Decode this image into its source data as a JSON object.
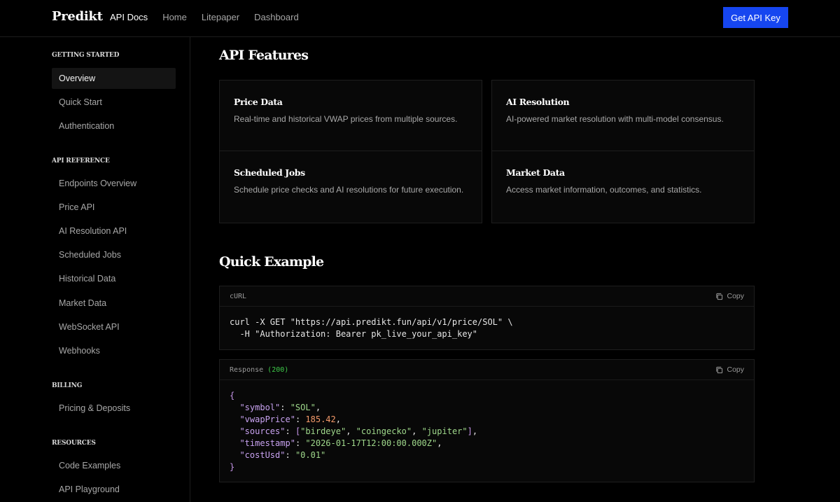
{
  "brand": "Predikt",
  "nav": [
    "API Docs",
    "Home",
    "Litepaper",
    "Dashboard"
  ],
  "cta": "Get API Key",
  "sidebar": {
    "sections": [
      {
        "title": "GETTING STARTED",
        "items": [
          "Overview",
          "Quick Start",
          "Authentication"
        ]
      },
      {
        "title": "API REFERENCE",
        "items": [
          "Endpoints Overview",
          "Price API",
          "AI Resolution API",
          "Scheduled Jobs",
          "Historical Data",
          "Market Data",
          "WebSocket API",
          "Webhooks"
        ]
      },
      {
        "title": "BILLING",
        "items": [
          "Pricing & Deposits"
        ]
      },
      {
        "title": "RESOURCES",
        "items": [
          "Code Examples",
          "API Playground"
        ]
      }
    ],
    "active": "Overview"
  },
  "features": {
    "title": "API Features",
    "cards": [
      {
        "title": "Price Data",
        "desc": "Real-time and historical VWAP prices from multiple sources."
      },
      {
        "title": "AI Resolution",
        "desc": "AI-powered market resolution with multi-model consensus."
      },
      {
        "title": "Scheduled Jobs",
        "desc": "Schedule price checks and AI resolutions for future execution."
      },
      {
        "title": "Market Data",
        "desc": "Access market information, outcomes, and statistics."
      }
    ]
  },
  "example": {
    "title": "Quick Example",
    "curl": {
      "label": "cURL",
      "copy": "Copy",
      "line1": "curl -X GET \"https://api.predikt.fun/api/v1/price/SOL\" \\",
      "line2": "  -H \"Authorization: Bearer pk_live_your_api_key\""
    },
    "response": {
      "label": "Response",
      "status": "(200)",
      "copy": "Copy",
      "open": "{",
      "close": "}",
      "symbol_key": "\"symbol\"",
      "symbol_val": "\"SOL\"",
      "vwap_key": "\"vwapPrice\"",
      "vwap_val": "185.42",
      "sources_key": "\"sources\"",
      "sources_vals": [
        "\"birdeye\"",
        "\"coingecko\"",
        "\"jupiter\""
      ],
      "timestamp_key": "\"timestamp\"",
      "timestamp_val": "\"2026-01-17T12:00:00.000Z\"",
      "cost_key": "\"costUsd\"",
      "cost_val": "\"0.01\""
    }
  }
}
